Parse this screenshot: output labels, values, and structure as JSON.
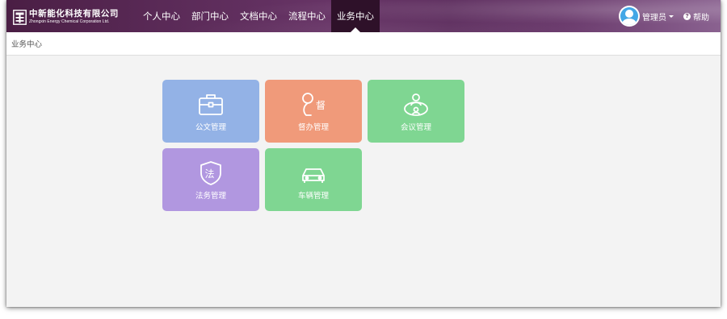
{
  "brand": {
    "name_cn": "中新能化科技有限公司",
    "name_en": "Zhongxin Energy Chemical Corporation Ltd."
  },
  "nav": [
    {
      "label": "个人中心",
      "active": false
    },
    {
      "label": "部门中心",
      "active": false
    },
    {
      "label": "文档中心",
      "active": false
    },
    {
      "label": "流程中心",
      "active": false
    },
    {
      "label": "业务中心",
      "active": true
    }
  ],
  "user": {
    "name": "管理员"
  },
  "help": {
    "label": "帮助"
  },
  "breadcrumb": "业务中心",
  "tiles": [
    {
      "label": "公文管理",
      "icon": "briefcase-icon",
      "color": "#93b2e6"
    },
    {
      "label": "督办管理",
      "icon": "supervise-icon",
      "color": "#f09a7a",
      "icon_text": "督"
    },
    {
      "label": "会议管理",
      "icon": "meeting-icon",
      "color": "#7fd692"
    },
    {
      "label": "法务管理",
      "icon": "legal-shield-icon",
      "color": "#b197e0",
      "icon_text": "法"
    },
    {
      "label": "车辆管理",
      "icon": "car-icon",
      "color": "#7fd692"
    }
  ]
}
